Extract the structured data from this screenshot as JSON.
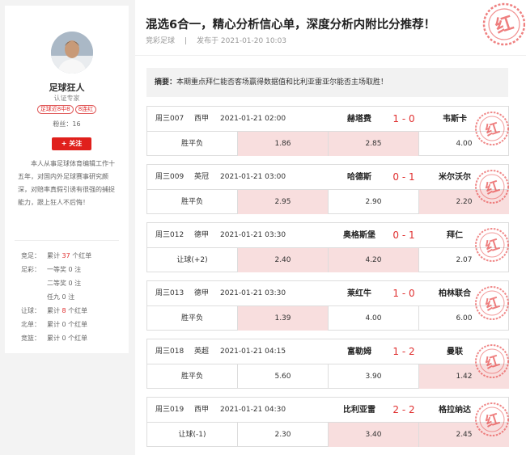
{
  "profile": {
    "name": "足球狂人",
    "cert": "认证专家",
    "badges": [
      "足球近8中8",
      "8连红"
    ],
    "fans_label": "粉丝：",
    "fans": "16",
    "follow": "+ 关注",
    "bio": "本人从事足球体育编辑工作十五年，对国内外足球赛事研究颇深，对赔率真假引诱有很强的捕捉能力，跟上狂人不后悔！",
    "stats": [
      {
        "label": "竞足：",
        "pre": "累计 ",
        "num": "37",
        "post": " 个红单"
      },
      {
        "label": "足彩：",
        "pre": "一等奖 0 注",
        "num": "",
        "post": ""
      },
      {
        "label": "",
        "pre": "二等奖 0 注",
        "num": "",
        "post": ""
      },
      {
        "label": "",
        "pre": "任九 0 注",
        "num": "",
        "post": ""
      },
      {
        "label": "让球：",
        "pre": "累计 ",
        "num": "8",
        "post": " 个红单"
      },
      {
        "label": "北单：",
        "pre": "累计 0 个红单",
        "num": "",
        "post": ""
      },
      {
        "label": "竞篮：",
        "pre": "累计 0 个红单",
        "num": "",
        "post": ""
      }
    ]
  },
  "article": {
    "title": "混选6合一，精心分析信心单，深度分析内附比分推荐！",
    "category": "竞彩足球",
    "sep": "|",
    "published": "发布于 2021-01-20 10:03",
    "summary_label": "摘要：",
    "summary": "本期重点拜仁能否客场赢得数据值和比利亚雷亚尔能否主场取胜！",
    "seal_char": "红"
  },
  "matches": [
    {
      "no": "周三007",
      "league": "西甲",
      "time": "2021-01-21 02:00",
      "home": "赫塔费",
      "score": "1 - 0",
      "away": "韦斯卡",
      "type": "胜平负",
      "odds": [
        "1.86",
        "2.85",
        "4.00"
      ],
      "hit": [
        true,
        true,
        false
      ]
    },
    {
      "no": "周三009",
      "league": "英冠",
      "time": "2021-01-21 03:00",
      "home": "哈德斯",
      "score": "0 - 1",
      "away": "米尔沃尔",
      "type": "胜平负",
      "odds": [
        "2.95",
        "2.90",
        "2.20"
      ],
      "hit": [
        true,
        false,
        true
      ]
    },
    {
      "no": "周三012",
      "league": "德甲",
      "time": "2021-01-21 03:30",
      "home": "奥格斯堡",
      "score": "0 - 1",
      "away": "拜仁",
      "type": "让球(+2)",
      "odds": [
        "2.40",
        "4.20",
        "2.07"
      ],
      "hit": [
        true,
        true,
        false
      ]
    },
    {
      "no": "周三013",
      "league": "德甲",
      "time": "2021-01-21 03:30",
      "home": "莱红牛",
      "score": "1 - 0",
      "away": "柏林联合",
      "type": "胜平负",
      "odds": [
        "1.39",
        "4.00",
        "6.00"
      ],
      "hit": [
        true,
        false,
        false
      ]
    },
    {
      "no": "周三018",
      "league": "英超",
      "time": "2021-01-21 04:15",
      "home": "富勒姆",
      "score": "1 - 2",
      "away": "曼联",
      "type": "胜平负",
      "odds": [
        "5.60",
        "3.90",
        "1.42"
      ],
      "hit": [
        false,
        false,
        true
      ]
    },
    {
      "no": "周三019",
      "league": "西甲",
      "time": "2021-01-21 04:30",
      "home": "比利亚雷",
      "score": "2 - 2",
      "away": "格拉纳达",
      "type": "让球(-1)",
      "odds": [
        "2.30",
        "3.40",
        "2.45"
      ],
      "hit": [
        false,
        true,
        true
      ]
    }
  ],
  "colors": {
    "accent": "#e0201c",
    "hit_bg": "#f8dede",
    "seal": "#e84a4a"
  }
}
